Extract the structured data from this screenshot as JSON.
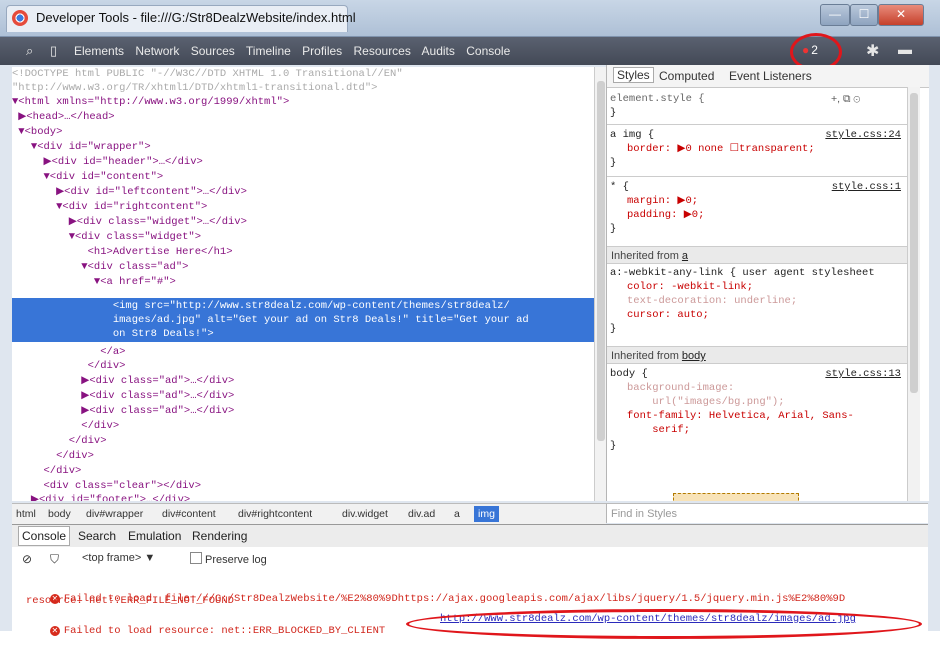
{
  "window": {
    "title": "Developer Tools - file:///G:/Str8DealzWebsite/index.html"
  },
  "toolbar": {
    "tabs": [
      "Elements",
      "Network",
      "Sources",
      "Timeline",
      "Profiles",
      "Resources",
      "Audits",
      "Console"
    ],
    "error_count": "2"
  },
  "elements": {
    "lines": [
      {
        "text": "<!DOCTYPE html PUBLIC \"-//W3C//DTD XHTML 1.0 Transitional//EN\""
      },
      {
        "text": "\"http://www.w3.org/TR/xhtml1/DTD/xhtml1-transitional.dtd\">"
      },
      {
        "text": "▼<html xmlns=\"http://www.w3.org/1999/xhtml\">"
      },
      {
        "text": " ▶<head>…</head>"
      },
      {
        "text": " ▼<body>"
      },
      {
        "text": "   ▼<div id=\"wrapper\">"
      },
      {
        "text": "     ▶<div id=\"header\">…</div>"
      },
      {
        "text": "     ▼<div id=\"content\">"
      },
      {
        "text": "       ▶<div id=\"leftcontent\">…</div>"
      },
      {
        "text": "       ▼<div id=\"rightcontent\">"
      },
      {
        "text": "         ▶<div class=\"widget\">…</div>"
      },
      {
        "text": "         ▼<div class=\"widget\">"
      },
      {
        "text": "            <h1>Advertise Here</h1>"
      },
      {
        "text": "           ▼<div class=\"ad\">"
      },
      {
        "text": "             ▼<a href=\"#\">"
      }
    ],
    "selected": [
      "                <img src=\"http://www.str8dealz.com/wp-content/themes/str8dealz/",
      "                images/ad.jpg\" alt=\"Get your ad on Str8 Deals!\" title=\"Get your ad",
      "                on Str8 Deals!\">"
    ],
    "after": [
      {
        "text": "              </a>"
      },
      {
        "text": "            </div>"
      },
      {
        "text": "           ▶<div class=\"ad\">…</div>"
      },
      {
        "text": "           ▶<div class=\"ad\">…</div>"
      },
      {
        "text": "           ▶<div class=\"ad\">…</div>"
      },
      {
        "text": "           </div>"
      },
      {
        "text": "         </div>"
      },
      {
        "text": "       </div>"
      },
      {
        "text": "     </div>"
      },
      {
        "text": "     <div class=\"clear\"></div>"
      },
      {
        "text": "   ▶<div id=\"footer\">…</div>"
      }
    ]
  },
  "styles": {
    "tabs": [
      "Styles",
      "Computed",
      "Event Listeners"
    ],
    "element_style": "element.style {",
    "close_brace": "}",
    "rule_img": {
      "selector": "a img {",
      "source": "style.css:24",
      "decl": "border: ▶0 none ☐transparent;"
    },
    "rule_star": {
      "selector": "* {",
      "source": "style.css:1",
      "decl1": "margin: ▶0;",
      "decl2": "padding: ▶0;"
    },
    "inherited_a": {
      "prefix": "Inherited from ",
      "link": "a"
    },
    "rule_ua": {
      "selector": "a:-webkit-any-link { user agent stylesheet",
      "decl1": "color: -webkit-link;",
      "decl2": "text-decoration: underline;",
      "decl3": "cursor: auto;"
    },
    "inherited_body": {
      "prefix": "Inherited from ",
      "link": "body"
    },
    "rule_body": {
      "selector": "body {",
      "source": "style.css:13",
      "decl1": "background-image:",
      "decl2": "    url(\"images/bg.png\");",
      "decl3": "font-family: Helvetica, Arial, Sans-",
      "decl4": "    serif;"
    },
    "find_placeholder": "Find in Styles"
  },
  "breadcrumb": [
    "html",
    "body",
    "div#wrapper",
    "div#content",
    "div#rightcontent",
    "div.widget",
    "div.ad",
    "a",
    "img"
  ],
  "drawer": {
    "tabs": [
      "Console",
      "Search",
      "Emulation",
      "Rendering"
    ]
  },
  "console": {
    "frame_label": "<top frame>",
    "preserve_log": "Preserve log",
    "error1_line1": "Failed to load  file:///G:/Str8DealzWebsite/%E2%80%9Dhttps://ajax.googleapis.com/ajax/libs/jquery/1.5/jquery.min.js%E2%80%9D",
    "error1_line2": "resource: net::ERR_FILE_NOT_FOUND",
    "error2_text": "Failed to load resource: net::ERR_BLOCKED_BY_CLIENT",
    "error2_link": "http://www.str8dealz.com/wp-content/themes/str8dealz/images/ad.jpg"
  },
  "colors": {
    "toolbar": "#4c5260",
    "selection": "#3875d7",
    "error": "#d1261c",
    "annotation": "#e0161b"
  }
}
